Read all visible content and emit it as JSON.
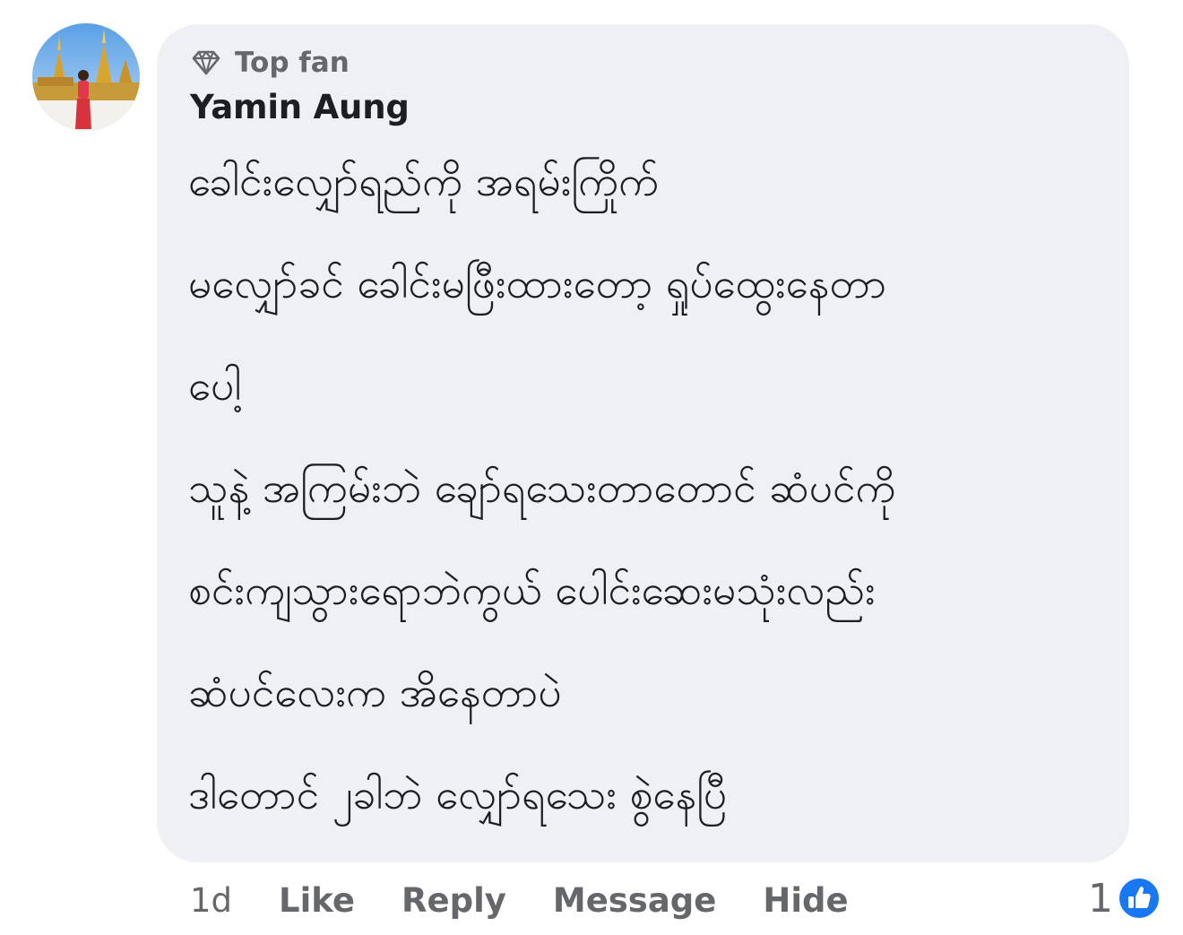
{
  "author": {
    "badge": "Top fan",
    "name": "Yamin Aung"
  },
  "comment": {
    "lines": [
      "ခေါင်းလျှော်ရည်ကို အရမ်းကြိုက်",
      "မလျှော်ခင် ခေါင်းမဖြီးထားတော့ ရှုပ်ထွေးနေတာ",
      "ပေါ့",
      "သူနဲ့ အကြမ်းဘဲ ချော်ရသေးတာတောင် ဆံပင်ကို",
      "စင်းကျသွားရောဘဲကွယ် ပေါင်းဆေးမသုံးလည်း",
      "ဆံပင်လေးက အိနေတာပဲ",
      "ဒါတောင် ၂ခါဘဲ လျှော်ရသေး စွဲနေပြီ"
    ]
  },
  "actions": {
    "time": "1d",
    "like": "Like",
    "reply": "Reply",
    "message": "Message",
    "hide": "Hide"
  },
  "reactions": {
    "count": "1",
    "icon": "like-icon",
    "color": "#1877f2"
  },
  "colors": {
    "bubble": "#eff0f3",
    "text": "#1c1e21",
    "secondary": "#65676b",
    "brand": "#1877f2"
  }
}
